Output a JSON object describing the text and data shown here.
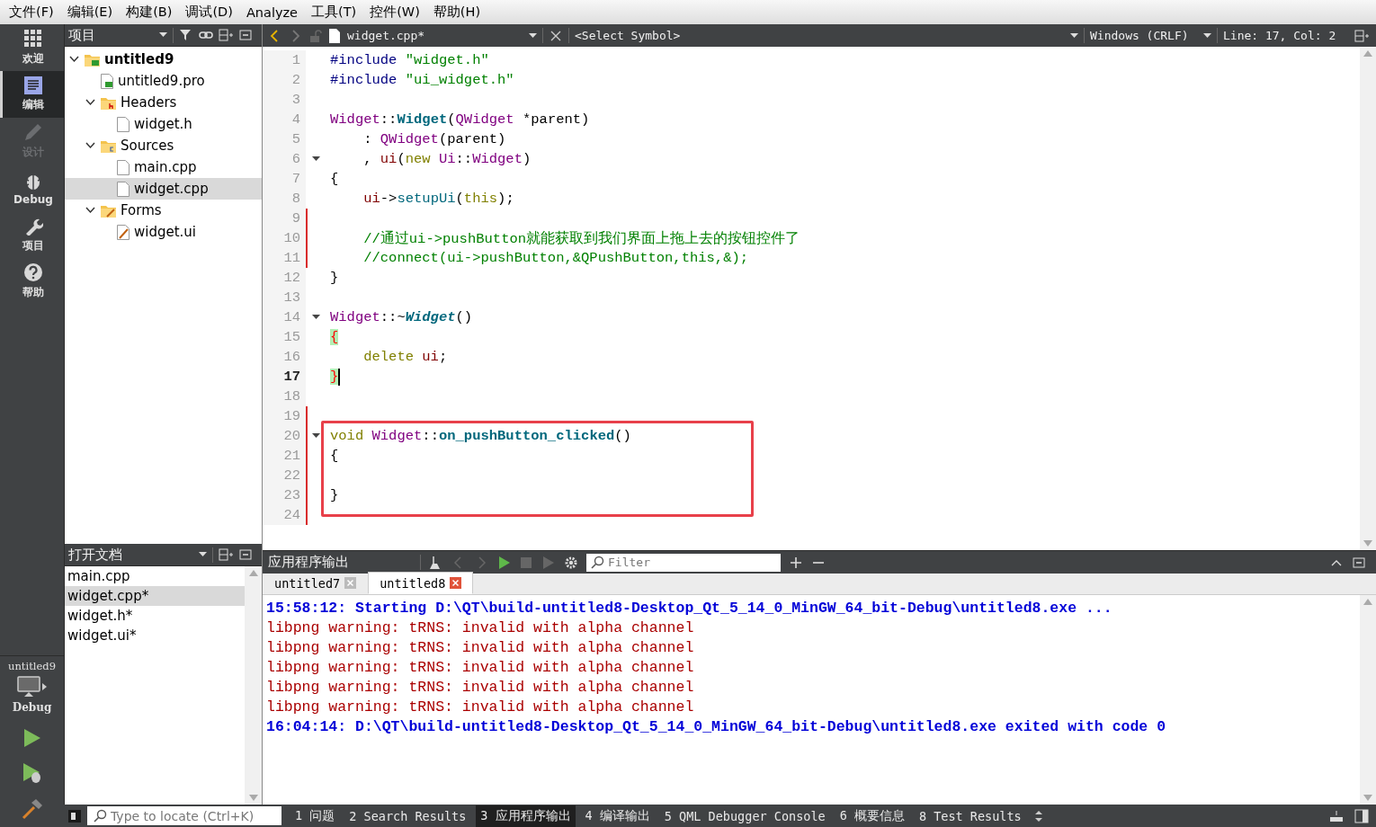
{
  "menu": [
    "文件(F)",
    "编辑(E)",
    "构建(B)",
    "调试(D)",
    "Analyze",
    "工具(T)",
    "控件(W)",
    "帮助(H)"
  ],
  "mode_bar": {
    "items": [
      {
        "label": "欢迎",
        "kind": "welcome",
        "selected": false,
        "disabled": false
      },
      {
        "label": "编辑",
        "kind": "edit",
        "selected": true,
        "disabled": false
      },
      {
        "label": "设计",
        "kind": "design",
        "selected": false,
        "disabled": true
      },
      {
        "label": "Debug",
        "kind": "debug",
        "selected": false,
        "disabled": false
      },
      {
        "label": "项目",
        "kind": "projects",
        "selected": false,
        "disabled": false
      },
      {
        "label": "帮助",
        "kind": "help",
        "selected": false,
        "disabled": false
      }
    ],
    "target": {
      "project": "untitled9",
      "build": "Debug"
    }
  },
  "project_panel": {
    "title": "项目",
    "tree": [
      {
        "label": "untitled9",
        "kind": "project",
        "expanded": true,
        "selected": false,
        "children": [
          {
            "label": "untitled9.pro",
            "kind": "pro_file",
            "selected": false
          },
          {
            "label": "Headers",
            "kind": "header_folder",
            "expanded": true,
            "selected": false,
            "children": [
              {
                "label": "widget.h",
                "kind": "file",
                "selected": false
              }
            ]
          },
          {
            "label": "Sources",
            "kind": "source_folder",
            "expanded": true,
            "selected": false,
            "children": [
              {
                "label": "main.cpp",
                "kind": "file",
                "selected": false
              },
              {
                "label": "widget.cpp",
                "kind": "file",
                "selected": true
              }
            ]
          },
          {
            "label": "Forms",
            "kind": "form_folder",
            "expanded": true,
            "selected": false,
            "children": [
              {
                "label": "widget.ui",
                "kind": "form_file",
                "selected": false
              }
            ]
          }
        ]
      }
    ]
  },
  "open_documents": {
    "title": "打开文档",
    "items": [
      {
        "label": "main.cpp",
        "selected": false
      },
      {
        "label": "widget.cpp*",
        "selected": true
      },
      {
        "label": "widget.h*",
        "selected": false
      },
      {
        "label": "widget.ui*",
        "selected": false
      }
    ]
  },
  "editor": {
    "file": "widget.cpp*",
    "symbol": "<Select Symbol>",
    "line_ending": "Windows (CRLF)",
    "position": "Line: 17, Col: 2",
    "lines": [
      {
        "number": "1",
        "tokens": [
          {
            "kind": "pre",
            "text": "#include"
          },
          {
            "kind": "str",
            "text": " \"widget.h\""
          }
        ]
      },
      {
        "number": "2",
        "tokens": [
          {
            "kind": "pre",
            "text": "#include"
          },
          {
            "kind": "str",
            "text": " \"ui_widget.h\""
          }
        ]
      },
      {
        "number": "3"
      },
      {
        "number": "4",
        "tokens": [
          {
            "kind": "type",
            "text": "Widget"
          },
          {
            "kind": "plain",
            "text": "::"
          },
          {
            "kind": "func",
            "text": "Widget"
          },
          {
            "kind": "plain",
            "text": "("
          },
          {
            "kind": "type",
            "text": "QWidget"
          },
          {
            "kind": "plain",
            "text": " *parent)"
          }
        ]
      },
      {
        "number": "5",
        "tokens": [
          {
            "kind": "plain",
            "text": "    : "
          },
          {
            "kind": "type",
            "text": "QWidget"
          },
          {
            "kind": "plain",
            "text": "(parent)"
          }
        ]
      },
      {
        "number": "6",
        "fold": true,
        "tokens": [
          {
            "kind": "plain",
            "text": "    , "
          },
          {
            "kind": "member",
            "text": "ui"
          },
          {
            "kind": "plain",
            "text": "("
          },
          {
            "kind": "kw",
            "text": "new"
          },
          {
            "kind": "type",
            "text": " Ui"
          },
          {
            "kind": "plain",
            "text": "::"
          },
          {
            "kind": "type",
            "text": "Widget"
          },
          {
            "kind": "plain",
            "text": ")"
          }
        ]
      },
      {
        "number": "7",
        "tokens": [
          {
            "kind": "plain",
            "text": "{"
          }
        ]
      },
      {
        "number": "8",
        "tokens": [
          {
            "kind": "member",
            "text": "    ui"
          },
          {
            "kind": "plain",
            "text": "->"
          },
          {
            "kind": "method",
            "text": "setupUi"
          },
          {
            "kind": "plain",
            "text": "("
          },
          {
            "kind": "kw",
            "text": "this"
          },
          {
            "kind": "plain",
            "text": ");"
          }
        ]
      },
      {
        "number": "9",
        "changed": true
      },
      {
        "number": "10",
        "changed": true,
        "tokens": [
          {
            "kind": "comment",
            "text": "    //通过ui->pushButton就能获取到我们界面上拖上去的按钮控件了"
          }
        ]
      },
      {
        "number": "11",
        "changed": true,
        "tokens": [
          {
            "kind": "comment",
            "text": "    //connect(ui->pushButton,&QPushButton,this,&);"
          }
        ]
      },
      {
        "number": "12",
        "tokens": [
          {
            "kind": "plain",
            "text": "}"
          }
        ]
      },
      {
        "number": "13"
      },
      {
        "number": "14",
        "fold": true,
        "tokens": [
          {
            "kind": "type",
            "text": "Widget"
          },
          {
            "kind": "plain",
            "text": "::~"
          },
          {
            "kind": "func_italic",
            "text": "Widget"
          },
          {
            "kind": "plain",
            "text": "()"
          }
        ]
      },
      {
        "number": "15",
        "tokens": [
          {
            "kind": "match",
            "text": "{"
          }
        ]
      },
      {
        "number": "16",
        "tokens": [
          {
            "kind": "kw",
            "text": "    delete"
          },
          {
            "kind": "member",
            "text": " ui"
          },
          {
            "kind": "plain",
            "text": ";"
          }
        ]
      },
      {
        "number": "17",
        "current": true,
        "tokens": [
          {
            "kind": "match",
            "text": "}"
          }
        ]
      },
      {
        "number": "18"
      },
      {
        "number": "19",
        "changed": true
      },
      {
        "number": "20",
        "changed": true,
        "fold": true,
        "boxed": true,
        "tokens": [
          {
            "kind": "kw",
            "text": "void"
          },
          {
            "kind": "type",
            "text": " Widget"
          },
          {
            "kind": "plain",
            "text": "::"
          },
          {
            "kind": "func",
            "text": "on_pushButton_clicked"
          },
          {
            "kind": "plain",
            "text": "()"
          }
        ]
      },
      {
        "number": "21",
        "changed": true,
        "boxed": true,
        "tokens": [
          {
            "kind": "plain",
            "text": "{"
          }
        ]
      },
      {
        "number": "22",
        "changed": true,
        "boxed": true
      },
      {
        "number": "23",
        "changed": true,
        "boxed": true,
        "tokens": [
          {
            "kind": "plain",
            "text": "}"
          }
        ]
      },
      {
        "number": "24",
        "changed": true
      }
    ]
  },
  "output": {
    "title": "应用程序输出",
    "filter_placeholder": "Filter",
    "tabs": [
      {
        "label": "untitled7",
        "selected": false
      },
      {
        "label": "untitled8",
        "selected": true
      }
    ],
    "lines": [
      {
        "kind": "info",
        "text": "15:58:12: Starting D:\\QT\\build-untitled8-Desktop_Qt_5_14_0_MinGW_64_bit-Debug\\untitled8.exe ..."
      },
      {
        "kind": "error",
        "text": "libpng warning: tRNS: invalid with alpha channel"
      },
      {
        "kind": "error",
        "text": "libpng warning: tRNS: invalid with alpha channel"
      },
      {
        "kind": "error",
        "text": "libpng warning: tRNS: invalid with alpha channel"
      },
      {
        "kind": "error",
        "text": "libpng warning: tRNS: invalid with alpha channel"
      },
      {
        "kind": "error",
        "text": "libpng warning: tRNS: invalid with alpha channel"
      },
      {
        "kind": "info",
        "text": "16:04:14: D:\\QT\\build-untitled8-Desktop_Qt_5_14_0_MinGW_64_bit-Debug\\untitled8.exe exited with code 0"
      }
    ]
  },
  "status_bar": {
    "locator_placeholder": "Type to locate (Ctrl+K)",
    "panes": [
      {
        "label": "1 问题",
        "selected": false
      },
      {
        "label": "2 Search Results",
        "selected": false
      },
      {
        "label": "3 应用程序输出",
        "selected": true
      },
      {
        "label": "4 编译输出",
        "selected": false
      },
      {
        "label": "5 QML Debugger Console",
        "selected": false
      },
      {
        "label": "6 概要信息",
        "selected": false
      },
      {
        "label": "8 Test Results",
        "selected": false
      }
    ]
  }
}
